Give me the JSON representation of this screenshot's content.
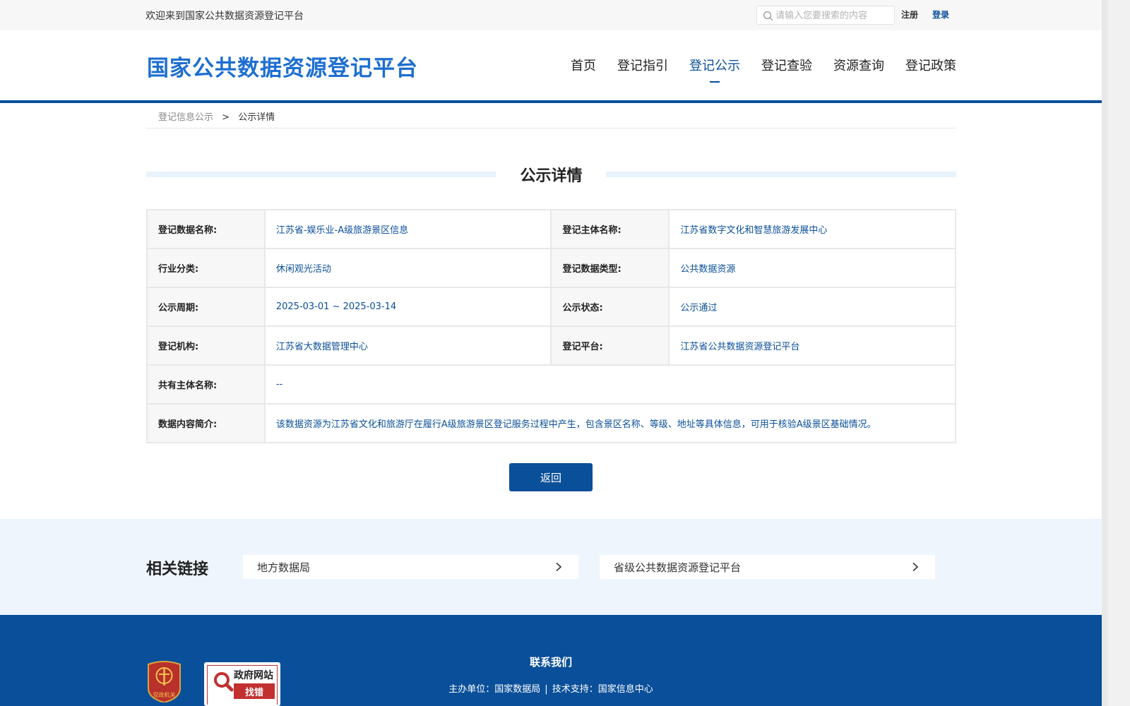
{
  "topbar": {
    "welcome": "欢迎来到国家公共数据资源登记平台",
    "search_placeholder": "请输入您要搜索的内容",
    "register": "注册",
    "login": "登录"
  },
  "header": {
    "site_title": "国家公共数据资源登记平台",
    "nav": [
      {
        "label": "首页",
        "active": false
      },
      {
        "label": "登记指引",
        "active": false
      },
      {
        "label": "登记公示",
        "active": true
      },
      {
        "label": "登记查验",
        "active": false
      },
      {
        "label": "资源查询",
        "active": false
      },
      {
        "label": "登记政策",
        "active": false
      }
    ]
  },
  "breadcrumb": {
    "parent": "登记信息公示",
    "separator": ">",
    "current": "公示详情"
  },
  "detail": {
    "title": "公示详情",
    "rows": [
      {
        "label1": "登记数据名称:",
        "value1": "江苏省-娱乐业-A级旅游景区信息",
        "label2": "登记主体名称:",
        "value2": "江苏省数字文化和智慧旅游发展中心"
      },
      {
        "label1": "行业分类:",
        "value1": "休闲观光活动",
        "label2": "登记数据类型:",
        "value2": "公共数据资源"
      },
      {
        "label1": "公示周期:",
        "value1": "2025-03-01 ~ 2025-03-14",
        "label2": "公示状态:",
        "value2": "公示通过"
      },
      {
        "label1": "登记机构:",
        "value1": "江苏省大数据管理中心",
        "label2": "登记平台:",
        "value2": "江苏省公共数据资源登记平台"
      }
    ],
    "co_owner": {
      "label": "共有主体名称:",
      "value": "--"
    },
    "summary": {
      "label": "数据内容简介:",
      "value": "该数据资源为江苏省文化和旅游厅在履行A级旅游景区登记服务过程中产生，包含景区名称、等级、地址等具体信息，可用于核验A级景区基础情况。"
    },
    "back_button": "返回"
  },
  "related": {
    "title": "相关链接",
    "links": [
      "地方数据局",
      "省级公共数据资源登记平台"
    ]
  },
  "footer": {
    "contact_title": "联系我们",
    "host_label": "主办单位：",
    "host": "国家数据局",
    "divider": "|",
    "tech_label": "技术支持：",
    "tech": "国家信息中心",
    "badge_title": "政府网站",
    "badge_sub": "找错",
    "emblem_text": "党政机关"
  },
  "colors": {
    "primary": "#0a4f99",
    "title_blue": "#1e6fd0",
    "related_bg": "#eff5fd",
    "label_bg": "#f7f7f7"
  }
}
